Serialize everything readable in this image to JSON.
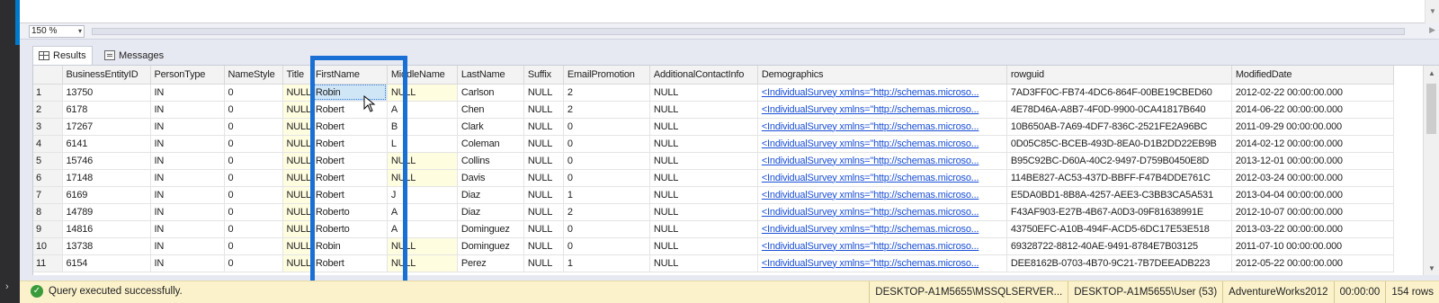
{
  "zoom": {
    "value": "150 %"
  },
  "tabs": {
    "results": "Results",
    "messages": "Messages"
  },
  "grid": {
    "columns": [
      "",
      "BusinessEntityID",
      "PersonType",
      "NameStyle",
      "Title",
      "FirstName",
      "MiddleName",
      "LastName",
      "Suffix",
      "EmailPromotion",
      "AdditionalContactInfo",
      "Demographics",
      "rowguid",
      "ModifiedDate"
    ],
    "rows": [
      [
        "1",
        "13750",
        "IN",
        "0",
        "NULL",
        "Robin",
        "NULL",
        "Carlson",
        "NULL",
        "2",
        "NULL",
        "<IndividualSurvey xmlns=\"http://schemas.microso...",
        "7AD3FF0C-FB74-4DC6-864F-00BE19CBED60",
        "2012-02-22 00:00:00.000"
      ],
      [
        "2",
        "6178",
        "IN",
        "0",
        "NULL",
        "Robert",
        "A",
        "Chen",
        "NULL",
        "2",
        "NULL",
        "<IndividualSurvey xmlns=\"http://schemas.microso...",
        "4E78D46A-A8B7-4F0D-9900-0CA41817B640",
        "2014-06-22 00:00:00.000"
      ],
      [
        "3",
        "17267",
        "IN",
        "0",
        "NULL",
        "Robert",
        "B",
        "Clark",
        "NULL",
        "0",
        "NULL",
        "<IndividualSurvey xmlns=\"http://schemas.microso...",
        "10B650AB-7A69-4DF7-836C-2521FE2A96BC",
        "2011-09-29 00:00:00.000"
      ],
      [
        "4",
        "6141",
        "IN",
        "0",
        "NULL",
        "Robert",
        "L",
        "Coleman",
        "NULL",
        "0",
        "NULL",
        "<IndividualSurvey xmlns=\"http://schemas.microso...",
        "0D05C85C-BCEB-493D-8EA0-D1B2DD22EB9B",
        "2014-02-12 00:00:00.000"
      ],
      [
        "5",
        "15746",
        "IN",
        "0",
        "NULL",
        "Robert",
        "NULL",
        "Collins",
        "NULL",
        "0",
        "NULL",
        "<IndividualSurvey xmlns=\"http://schemas.microso...",
        "B95C92BC-D60A-40C2-9497-D759B0450E8D",
        "2013-12-01 00:00:00.000"
      ],
      [
        "6",
        "17148",
        "IN",
        "0",
        "NULL",
        "Robert",
        "NULL",
        "Davis",
        "NULL",
        "0",
        "NULL",
        "<IndividualSurvey xmlns=\"http://schemas.microso...",
        "114BE827-AC53-437D-BBFF-F47B4DDE761C",
        "2012-03-24 00:00:00.000"
      ],
      [
        "7",
        "6169",
        "IN",
        "0",
        "NULL",
        "Robert",
        "J",
        "Diaz",
        "NULL",
        "1",
        "NULL",
        "<IndividualSurvey xmlns=\"http://schemas.microso...",
        "E5DA0BD1-8B8A-4257-AEE3-C3BB3CA5A531",
        "2013-04-04 00:00:00.000"
      ],
      [
        "8",
        "14789",
        "IN",
        "0",
        "NULL",
        "Roberto",
        "A",
        "Diaz",
        "NULL",
        "2",
        "NULL",
        "<IndividualSurvey xmlns=\"http://schemas.microso...",
        "F43AF903-E27B-4B67-A0D3-09F81638991E",
        "2012-10-07 00:00:00.000"
      ],
      [
        "9",
        "14816",
        "IN",
        "0",
        "NULL",
        "Roberto",
        "A",
        "Dominguez",
        "NULL",
        "0",
        "NULL",
        "<IndividualSurvey xmlns=\"http://schemas.microso...",
        "43750EFC-A10B-494F-ACD5-6DC17E53E518",
        "2013-03-22 00:00:00.000"
      ],
      [
        "10",
        "13738",
        "IN",
        "0",
        "NULL",
        "Robin",
        "NULL",
        "Dominguez",
        "NULL",
        "0",
        "NULL",
        "<IndividualSurvey xmlns=\"http://schemas.microso...",
        "69328722-8812-40AE-9491-8784E7B03125",
        "2011-07-10 00:00:00.000"
      ],
      [
        "11",
        "6154",
        "IN",
        "0",
        "NULL",
        "Robert",
        "NULL",
        "Perez",
        "NULL",
        "1",
        "NULL",
        "<IndividualSurvey xmlns=\"http://schemas.microso...",
        "DEE8162B-0703-4B70-9C21-7B7DEEADB223",
        "2012-05-22 00:00:00.000"
      ]
    ],
    "selected_cell": {
      "row": 0,
      "column": "FirstName"
    }
  },
  "status": {
    "message": "Query executed successfully.",
    "server": "DESKTOP-A1M5655\\MSSQLSERVER...",
    "user": "DESKTOP-A1M5655\\User (53)",
    "database": "AdventureWorks2012",
    "elapsed": "00:00:00",
    "row_count": "154 rows"
  },
  "colors": {
    "highlight_box": "#1a6fd4",
    "null_cell": "#fffde0",
    "status_bar": "#fbf2cc",
    "link": "#1a4fd6"
  }
}
